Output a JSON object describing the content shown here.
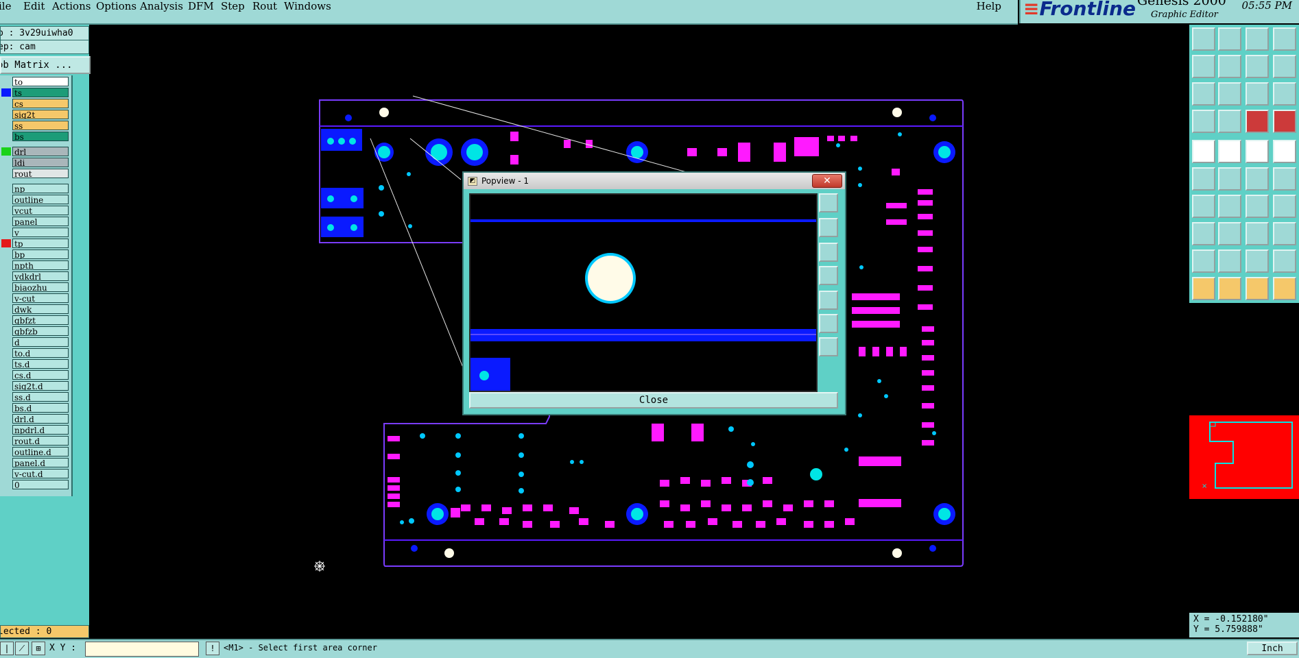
{
  "menubar": {
    "items": [
      "ile",
      "Edit",
      "Actions",
      "Options",
      "Analysis",
      "DFM",
      "Step",
      "Rout",
      "Windows"
    ],
    "help": "Help"
  },
  "brand": {
    "logo": "Frontline",
    "product": "Genesis 2000",
    "subtitle": "Graphic Editor",
    "time": "05:55 PM"
  },
  "left": {
    "job": "b : 3v29uiwha0",
    "step": "ep: cam",
    "matrix_button": "ob Matrix ...",
    "layers": [
      {
        "name": "to",
        "bg": "#ffffff",
        "mark": ""
      },
      {
        "name": "ts",
        "bg": "#1c9c78",
        "mark": "#0a1aff"
      },
      {
        "name": "cs",
        "bg": "#f5c86a",
        "mark": ""
      },
      {
        "name": "sig2t",
        "bg": "#f5c86a",
        "mark": ""
      },
      {
        "name": "ss",
        "bg": "#f5c86a",
        "mark": ""
      },
      {
        "name": "bs",
        "bg": "#1c9c78",
        "mark": ""
      },
      {
        "name": "drl",
        "bg": "#a9b6ba",
        "mark": "#1ad21a"
      },
      {
        "name": "ldi",
        "bg": "#a9b6ba",
        "mark": ""
      },
      {
        "name": "rout",
        "bg": "#e0e6e6",
        "mark": ""
      },
      {
        "name": "np",
        "bg": "#b5e6e1",
        "mark": ""
      },
      {
        "name": "outline",
        "bg": "#b5e6e1",
        "mark": ""
      },
      {
        "name": "vcut",
        "bg": "#b5e6e1",
        "mark": ""
      },
      {
        "name": "panel",
        "bg": "#b5e6e1",
        "mark": ""
      },
      {
        "name": "v",
        "bg": "#b5e6e1",
        "mark": ""
      },
      {
        "name": "tp",
        "bg": "#b5e6e1",
        "mark": "#e41a1a"
      },
      {
        "name": "bp",
        "bg": "#b5e6e1",
        "mark": ""
      },
      {
        "name": "npth",
        "bg": "#b5e6e1",
        "mark": ""
      },
      {
        "name": "ydkdrl",
        "bg": "#b5e6e1",
        "mark": ""
      },
      {
        "name": "biaozhu",
        "bg": "#b5e6e1",
        "mark": ""
      },
      {
        "name": "v-cut",
        "bg": "#b5e6e1",
        "mark": ""
      },
      {
        "name": "dwk",
        "bg": "#b5e6e1",
        "mark": ""
      },
      {
        "name": "gbfzt",
        "bg": "#b5e6e1",
        "mark": ""
      },
      {
        "name": "gbfzb",
        "bg": "#b5e6e1",
        "mark": ""
      },
      {
        "name": "d",
        "bg": "#b5e6e1",
        "mark": ""
      },
      {
        "name": "to.d",
        "bg": "#b5e6e1",
        "mark": ""
      },
      {
        "name": "ts.d",
        "bg": "#b5e6e1",
        "mark": ""
      },
      {
        "name": "cs.d",
        "bg": "#b5e6e1",
        "mark": ""
      },
      {
        "name": "sig2t.d",
        "bg": "#b5e6e1",
        "mark": ""
      },
      {
        "name": "ss.d",
        "bg": "#b5e6e1",
        "mark": ""
      },
      {
        "name": "bs.d",
        "bg": "#b5e6e1",
        "mark": ""
      },
      {
        "name": "drl.d",
        "bg": "#b5e6e1",
        "mark": ""
      },
      {
        "name": "npdrl.d",
        "bg": "#b5e6e1",
        "mark": ""
      },
      {
        "name": "rout.d",
        "bg": "#b5e6e1",
        "mark": ""
      },
      {
        "name": "outline.d",
        "bg": "#b5e6e1",
        "mark": ""
      },
      {
        "name": "panel.d",
        "bg": "#b5e6e1",
        "mark": ""
      },
      {
        "name": "v-cut.d",
        "bg": "#b5e6e1",
        "mark": ""
      },
      {
        "name": "0",
        "bg": "#b5e6e1",
        "mark": ""
      }
    ],
    "selected": "lected : 0"
  },
  "popup": {
    "title": "Popview - 1",
    "close_x": "✕",
    "close_button": "Close"
  },
  "coords": {
    "x": "X = -0.152180\"",
    "y": "Y = 5.759888\""
  },
  "statusbar": {
    "xy_label": "X Y :",
    "xy_value": "",
    "message": "<M1> - Select first area corner",
    "unit": "Inch"
  },
  "colors": {
    "panel_teal": "#5fd0c6",
    "outline": "#7a3cff",
    "copper_blue": "#0a1aff",
    "pad_cyan": "#00e5e5",
    "smd_magenta": "#ff1aff"
  }
}
